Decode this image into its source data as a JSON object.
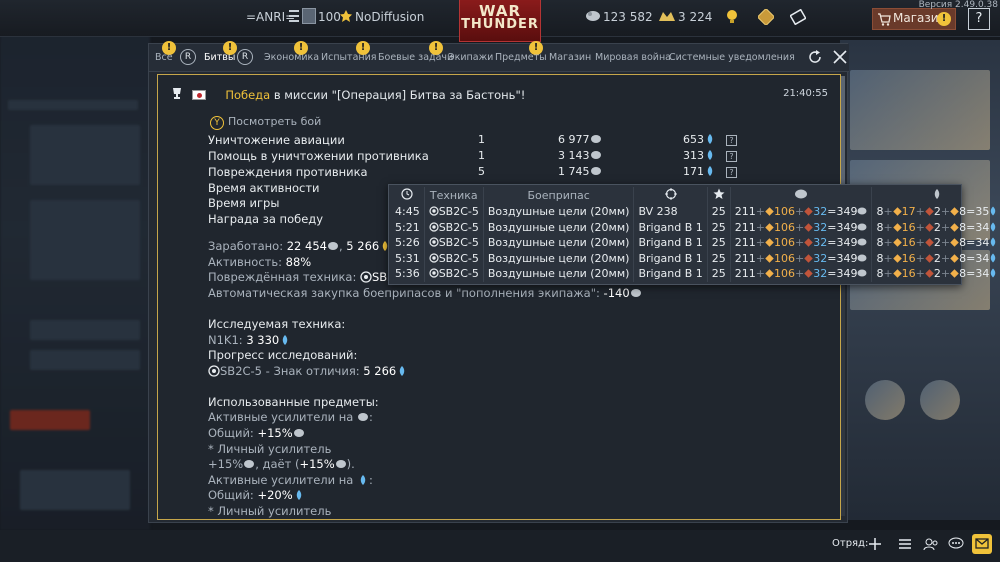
{
  "topbar": {
    "nickname": "=ANRI=",
    "golden_eagles": "100",
    "clan": "NoDiffusion",
    "logo_line1": "WAR",
    "logo_line2": "THUNDER",
    "silver_lions": "123 582",
    "eagles_alt": "3 224",
    "shop_label": "Магазин",
    "help_label": "?",
    "version": "Версия 2.49.0.38"
  },
  "tabs": {
    "items": [
      "Все",
      "Битвы",
      "Экономика",
      "Испытания",
      "Боевые задачи",
      "Экипажи",
      "Предметы",
      "Магазин",
      "Мировая война",
      "Системные уведомления"
    ],
    "r_label": "R",
    "alert": "!"
  },
  "mission": {
    "result": "Победа",
    "text": " в миссии \"[Операция] Битва за Бастонь\"!",
    "time": "21:40:55",
    "replay": "Посмотреть бой",
    "replay_key": "Y"
  },
  "stats": [
    {
      "label": "Уничтожение авиации",
      "count": "1",
      "silver": "6 977",
      "rp": "653"
    },
    {
      "label": "Помощь в уничтожении противника",
      "count": "1",
      "silver": "3 143",
      "rp": "313"
    },
    {
      "label": "Повреждения противника",
      "count": "5",
      "silver": "1 745",
      "rp": "171"
    },
    {
      "label": "Время активности",
      "count": "",
      "silver": "",
      "rp": ""
    },
    {
      "label": "Время игры",
      "count": "",
      "silver": "",
      "rp": ""
    },
    {
      "label": "Награда за победу",
      "count": "",
      "silver": "",
      "rp": ""
    }
  ],
  "summary": {
    "earned_label": "Заработано: ",
    "earned_silver": "22 454",
    "earned_rp": "5 266",
    "activity_label": "Активность: ",
    "activity_value": "88%",
    "damaged_label": "Повреждённая техника: ",
    "damaged_value": "SB2C-5",
    "autobuy_text": "Автоматическая закупка боеприпасов и \"пополнения экипажа\": ",
    "autobuy_value": "-140",
    "research_title": "Исследуемая техника:",
    "research_unit": "N1K1: ",
    "research_value": "3 330",
    "progress_title": "Прогресс исследований:",
    "progress_unit": "SB2C-5 - Знак отличия: ",
    "progress_value": "5 266",
    "items_title": "Использованные предметы:",
    "boost_silver_label": "Активные усилители на ",
    "common_label": "Общий: ",
    "common_silver": "+15%",
    "personal_label": "* Личный усилитель",
    "personal_line_a": "+15%",
    "personal_line_b": ", даёт (",
    "personal_line_c": "+15%",
    "personal_line_d": ").",
    "boost_rp_label": "Активные усилители на ",
    "common_rp": "+20%",
    "personal_label2": "* Личный усилитель"
  },
  "tooltip": {
    "headers": [
      "Техника",
      "Боеприпас",
      "",
      "",
      "",
      ""
    ],
    "rows": [
      {
        "time": "4:45",
        "vehicle": "SB2C-5",
        "ammo": "Воздушные цели (20мм)",
        "target": "BV 238",
        "score": "25",
        "s1": "211",
        "s2": "106",
        "s3": "32",
        "stotal": "=349",
        "r1": "8",
        "r2": "17",
        "r3": "2",
        "r4": "8",
        "rtotal": "=35"
      },
      {
        "time": "5:21",
        "vehicle": "SB2C-5",
        "ammo": "Воздушные цели (20мм)",
        "target": "Brigand B 1",
        "score": "25",
        "s1": "211",
        "s2": "106",
        "s3": "32",
        "stotal": "=349",
        "r1": "8",
        "r2": "16",
        "r3": "2",
        "r4": "8",
        "rtotal": "=34"
      },
      {
        "time": "5:26",
        "vehicle": "SB2C-5",
        "ammo": "Воздушные цели (20мм)",
        "target": "Brigand B 1",
        "score": "25",
        "s1": "211",
        "s2": "106",
        "s3": "32",
        "stotal": "=349",
        "r1": "8",
        "r2": "16",
        "r3": "2",
        "r4": "8",
        "rtotal": "=34"
      },
      {
        "time": "5:31",
        "vehicle": "SB2C-5",
        "ammo": "Воздушные цели (20мм)",
        "target": "Brigand B 1",
        "score": "25",
        "s1": "211",
        "s2": "106",
        "s3": "32",
        "stotal": "=349",
        "r1": "8",
        "r2": "16",
        "r3": "2",
        "r4": "8",
        "rtotal": "=34"
      },
      {
        "time": "5:36",
        "vehicle": "SB2C-5",
        "ammo": "Воздушные цели (20мм)",
        "target": "Brigand B 1",
        "score": "25",
        "s1": "211",
        "s2": "106",
        "s3": "32",
        "stotal": "=349",
        "r1": "8",
        "r2": "16",
        "r3": "2",
        "r4": "8",
        "rtotal": "=34"
      }
    ]
  },
  "bottombar": {
    "squad_label": "Отряд:"
  },
  "colors": {
    "gold": "#f0c23a",
    "accent_frame": "#c6a64a",
    "blue_rp": "#67b9ef",
    "orange": "#f2b04a"
  },
  "icons": [
    "silver-lion-icon",
    "research-point-icon",
    "golden-eagle-icon",
    "cup-icon",
    "clock-icon",
    "crosshair-icon",
    "star-icon",
    "refresh-icon",
    "close-icon",
    "cart-icon",
    "plus-icon",
    "list-icon",
    "chat-icon",
    "mail-icon"
  ]
}
